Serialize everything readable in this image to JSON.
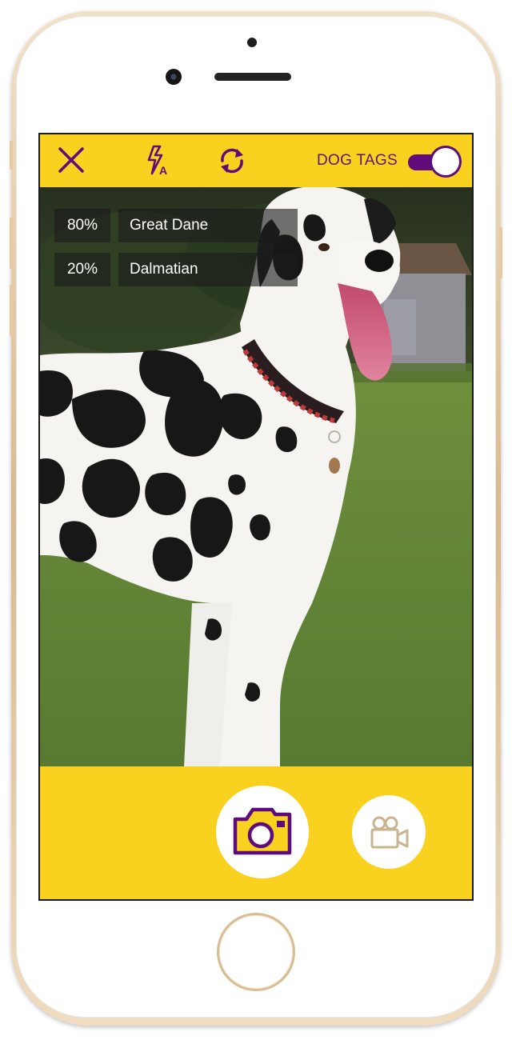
{
  "toolbar": {
    "close_icon": "close-icon",
    "flash_icon": "flash-auto-icon",
    "flip_icon": "flip-camera-icon",
    "toggle_label": "DOG TAGS",
    "toggle_on": true
  },
  "tags": [
    {
      "percent": "80%",
      "breed": "Great Dane"
    },
    {
      "percent": "20%",
      "breed": "Dalmatian"
    }
  ],
  "bottom": {
    "photo_icon": "camera-icon",
    "video_icon": "video-camera-icon"
  },
  "colors": {
    "accent_yellow": "#f8d21e",
    "accent_purple": "#5e0b7b",
    "video_icon_tan": "#c8b48e"
  }
}
